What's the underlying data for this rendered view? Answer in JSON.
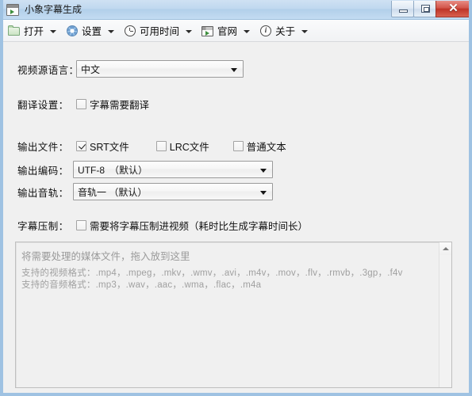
{
  "window": {
    "title": "小象字幕生成",
    "icon": "app-window-icon",
    "buttons": {
      "minimize": "–",
      "maximize": "□",
      "close": "✕"
    }
  },
  "toolbar": {
    "items": [
      {
        "label": "打开",
        "icon": "folder-open-icon",
        "caret": true
      },
      {
        "label": "设置",
        "icon": "gear-icon",
        "caret": true
      },
      {
        "label": "可用时间",
        "icon": "clock-icon",
        "caret": true
      },
      {
        "label": "官网",
        "icon": "website-icon",
        "caret": true
      },
      {
        "label": "关于",
        "icon": "info-icon",
        "caret": true
      }
    ]
  },
  "form": {
    "source_language": {
      "label": "视频源语言：",
      "value": "中文"
    },
    "translate": {
      "label": "翻译设置：",
      "checkbox_label": "字幕需要翻译",
      "checked": false
    },
    "output_files": {
      "label": "输出文件：",
      "options": [
        {
          "label": "SRT文件",
          "checked": true
        },
        {
          "label": "LRC文件",
          "checked": false
        },
        {
          "label": "普通文本",
          "checked": false
        }
      ]
    },
    "output_encoding": {
      "label": "输出编码：",
      "value": "UTF-8　（默认）"
    },
    "output_track": {
      "label": "输出音轨：",
      "value": "音轨一 （默认）"
    },
    "burn_in": {
      "label": "字幕压制：",
      "checkbox_label": "需要将字幕压制进视频（耗时比生成字幕时间长）",
      "checked": false
    }
  },
  "droparea": {
    "hint": "将需要处理的媒体文件，拖入放到这里",
    "video_formats": "支持的视频格式：.mp4，.mpeg，.mkv，.wmv，.avi，.m4v，.mov，.flv，.rmvb，.3gp，.f4v",
    "audio_formats": "支持的音频格式：.mp3，.wav，.aac，.wma，.flac，.m4a"
  },
  "colors": {
    "titlebar": "#c0d8ef",
    "window_bg": "#f0f0f0",
    "close_button": "#be3327",
    "placeholder_text": "#9a9a9a"
  }
}
